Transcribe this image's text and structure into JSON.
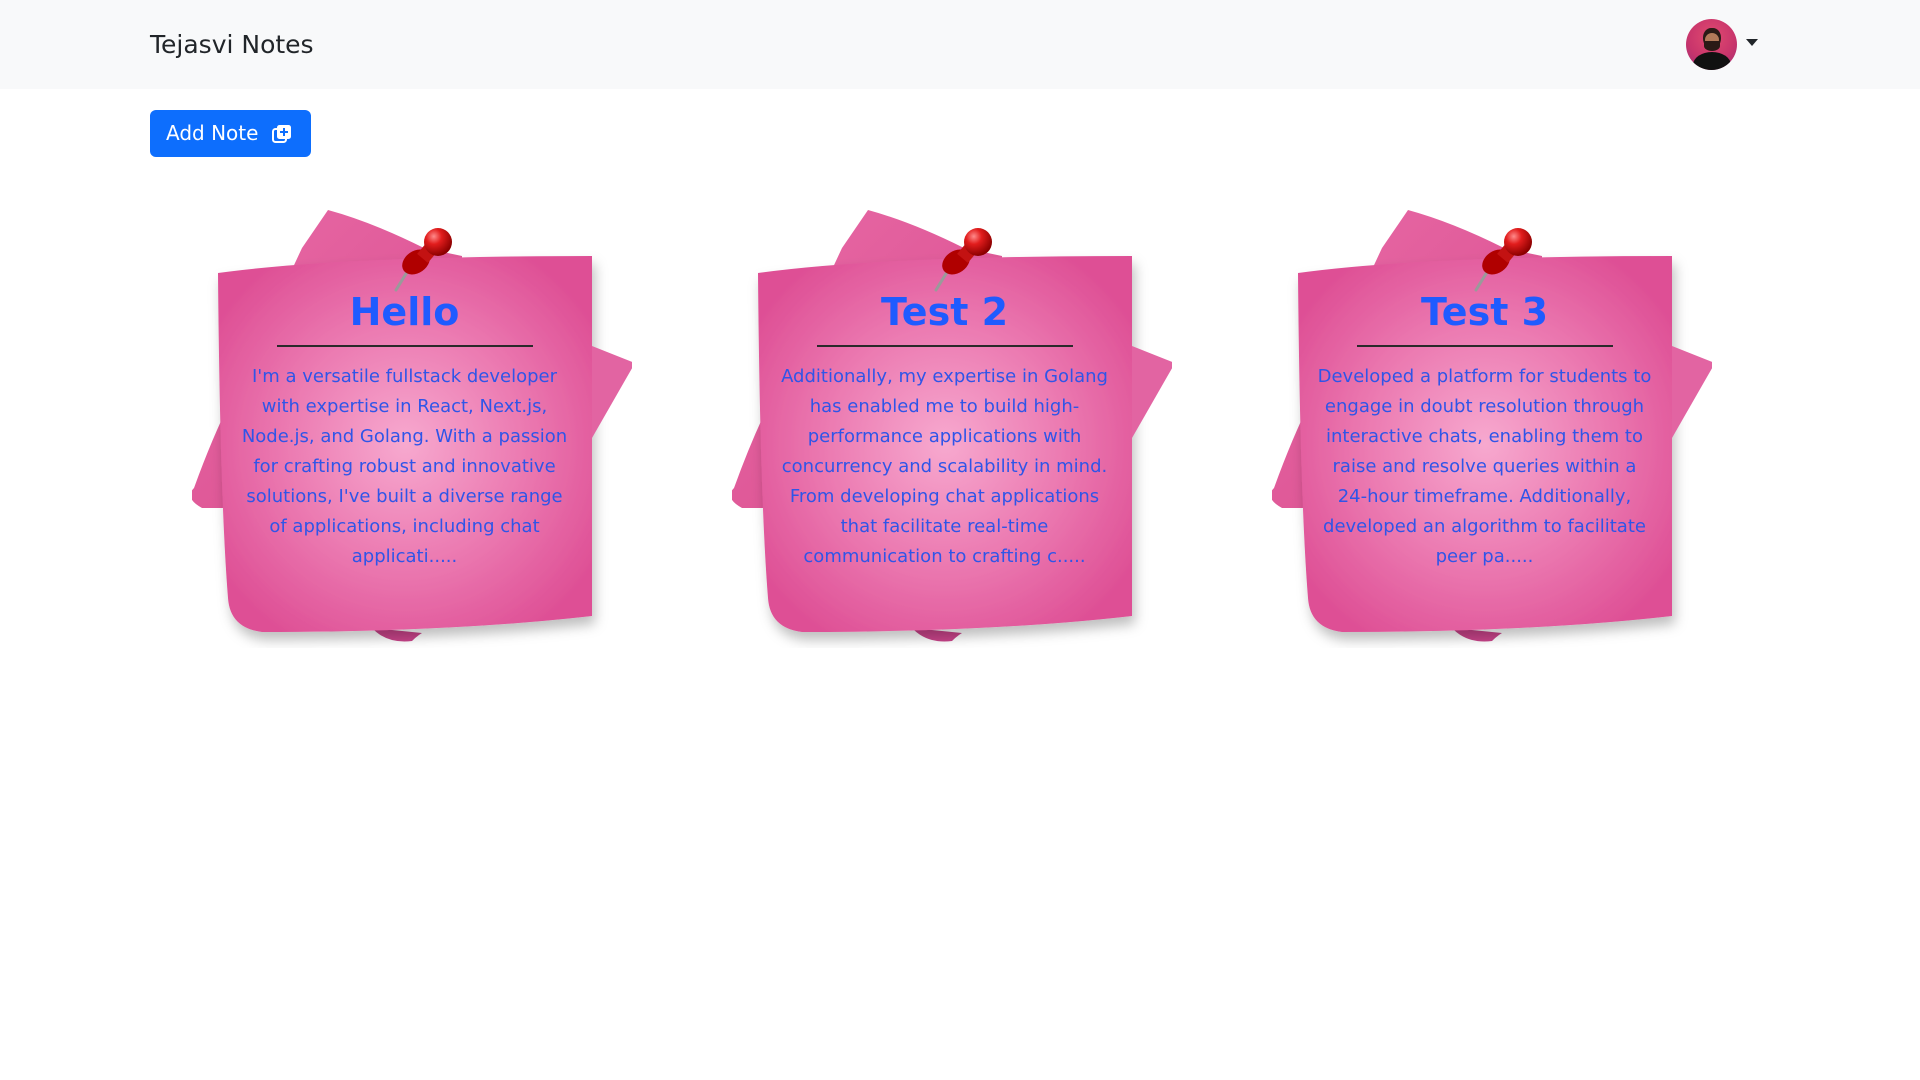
{
  "navbar": {
    "brand": "Tejasvi Notes"
  },
  "toolbar": {
    "add_note_label": "Add Note"
  },
  "notes": [
    {
      "title": "Hello",
      "body": "I'm a versatile fullstack developer with expertise in React, Next.js, Node.js, and Golang. With a passion for crafting robust and innovative solutions, I've built a diverse range of applications, including chat applicati....."
    },
    {
      "title": "Test 2",
      "body": "Additionally, my expertise in Golang has enabled me to build high-performance applications with concurrency and scalability in mind. From developing chat applications that facilitate real-time communication to crafting c....."
    },
    {
      "title": "Test 3",
      "body": "Developed a platform for students to engage in doubt resolution through interactive chats, enabling them to raise and resolve queries within a 24-hour timeframe. Additionally, developed an algorithm to facilitate peer pa....."
    }
  ],
  "colors": {
    "primary": "#0d6efd",
    "note_pink": "#e25a9b",
    "note_title": "#1f5bff",
    "navbar_bg": "#f8f9fa"
  },
  "icons": {
    "add_note": "add-note-icon",
    "pin": "pushpin-icon",
    "profile_caret": "chevron-down-icon"
  }
}
